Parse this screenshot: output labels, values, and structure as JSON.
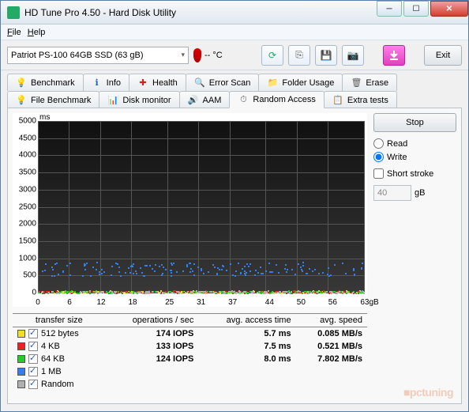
{
  "window": {
    "title": "HD Tune Pro 4.50 - Hard Disk Utility"
  },
  "menu": {
    "file": "File",
    "help": "Help"
  },
  "toolbar": {
    "drive": "Patriot PS-100 64GB SSD (63 gB)",
    "temp": "-- °C",
    "exit": "Exit"
  },
  "tabs": {
    "row1": [
      {
        "label": "Benchmark",
        "icon": "💡",
        "color": "#e8c020"
      },
      {
        "label": "Info",
        "icon": "ℹ",
        "color": "#2060c0"
      },
      {
        "label": "Health",
        "icon": "✚",
        "color": "#d02020"
      },
      {
        "label": "Error Scan",
        "icon": "🔍",
        "color": "#20a040"
      },
      {
        "label": "Folder Usage",
        "icon": "📁",
        "color": "#e0a020"
      },
      {
        "label": "Erase",
        "icon": "🗑",
        "color": "#606060"
      }
    ],
    "row2": [
      {
        "label": "File Benchmark",
        "icon": "💡",
        "color": "#e8c020"
      },
      {
        "label": "Disk monitor",
        "icon": "📊",
        "color": "#e06030"
      },
      {
        "label": "AAM",
        "icon": "🔊",
        "color": "#e0a020"
      },
      {
        "label": "Random Access",
        "icon": "⏱",
        "color": "#606060",
        "active": true
      },
      {
        "label": "Extra tests",
        "icon": "📋",
        "color": "#20a0c0"
      }
    ]
  },
  "side": {
    "stop": "Stop",
    "read": "Read",
    "write": "Write",
    "short_stroke": "Short stroke",
    "stroke_val": "40",
    "stroke_unit": "gB"
  },
  "chart_data": {
    "type": "scatter",
    "title": "",
    "ylabel": "ms",
    "xlabel": "",
    "xlim": [
      0,
      63
    ],
    "ylim": [
      0,
      5000
    ],
    "xticks": [
      0,
      6,
      12,
      18,
      25,
      31,
      37,
      44,
      50,
      56,
      63
    ],
    "xunit": "gB",
    "yticks": [
      0,
      500,
      1000,
      1500,
      2000,
      2500,
      3000,
      3500,
      4000,
      4500,
      5000
    ],
    "series": [
      {
        "name": "512 bytes",
        "color": "#f0e020",
        "band_ms": 30
      },
      {
        "name": "4 KB",
        "color": "#f02020",
        "band_ms": 30
      },
      {
        "name": "64 KB",
        "color": "#20d020",
        "band_ms": 30
      },
      {
        "name": "1 MB",
        "color": "#3080f0",
        "band_ms": 600
      },
      {
        "name": "Random",
        "color": "#b0b0b0",
        "band_ms": 30
      }
    ]
  },
  "results": {
    "headers": [
      "transfer size",
      "operations / sec",
      "avg. access time",
      "avg. speed"
    ],
    "rows": [
      {
        "color": "#f0e020",
        "size": "512 bytes",
        "iops": "174 IOPS",
        "access": "5.7 ms",
        "speed": "0.085 MB/s"
      },
      {
        "color": "#f02020",
        "size": "4 KB",
        "iops": "133 IOPS",
        "access": "7.5 ms",
        "speed": "0.521 MB/s"
      },
      {
        "color": "#20d020",
        "size": "64 KB",
        "iops": "124 IOPS",
        "access": "8.0 ms",
        "speed": "7.802 MB/s"
      },
      {
        "color": "#3080f0",
        "size": "1 MB",
        "iops": "",
        "access": "",
        "speed": ""
      },
      {
        "color": "#b0b0b0",
        "size": "Random",
        "iops": "",
        "access": "",
        "speed": ""
      }
    ]
  },
  "watermark": "■pctuning"
}
